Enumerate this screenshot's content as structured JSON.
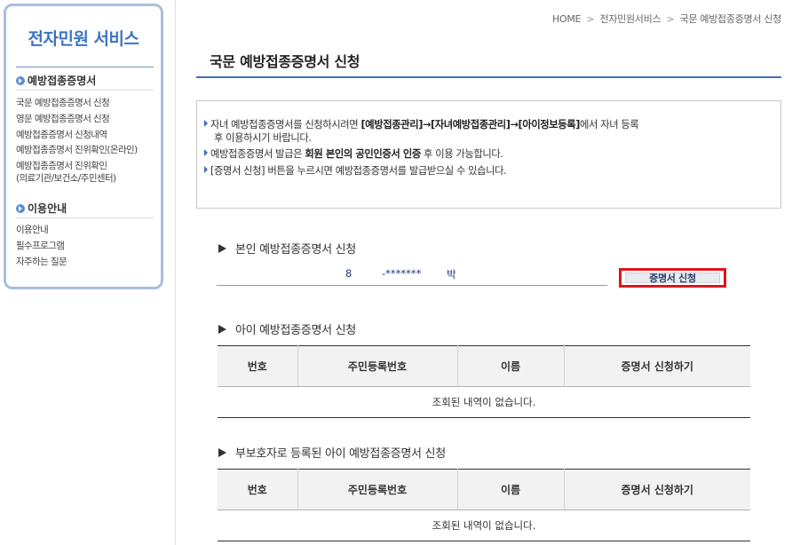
{
  "sidebar": {
    "title": "전자민원 서비스",
    "section1": {
      "heading": "예방접종증명서",
      "items": [
        {
          "label": "국문 예방접종증명서 신청"
        },
        {
          "label": "영문 예방접종증명서 신청"
        },
        {
          "label": "예방접종증명서 신청내역"
        },
        {
          "label": "예방접종증명서 진위확인(온라인)"
        },
        {
          "label": "예방접종증명서 진위확인"
        },
        {
          "label": "(의료기관/보건소/주민센터)"
        }
      ]
    },
    "section2": {
      "heading": "이용안내",
      "items": [
        {
          "label": "이용안내"
        },
        {
          "label": "필수프로그램"
        },
        {
          "label": "자주하는 질문"
        }
      ]
    }
  },
  "breadcrumb": {
    "home": "HOME",
    "level1": "전자민원서비스",
    "level2": "국문 예방접종증명서 신청",
    "separator": ">"
  },
  "page_title": "국문 예방접종증명서 신청",
  "notice": {
    "line1_a": "자녀 예방접종증명서를 신청하시려면 ",
    "line1_b": "[예방접종관리]→[자녀예방접종관리]→[아이정보등록]",
    "line1_c": "에서 자녀 등록",
    "line1_d": "후 이용하시기 바랍니다.",
    "line2_a": "예방접종증명서 발급은 ",
    "line2_b": "회원 본인의 공인인증서 인증",
    "line2_c": " 후 이용 가능합니다.",
    "line3": "[증명서 신청] 버튼을 누르시면 예방접종증명서를 발급받으실 수 있습니다."
  },
  "self_section": {
    "title": "본인 예방접종증명서 신청",
    "rrn_prefix": "8",
    "rrn_mask": "-*******",
    "name": "박",
    "button_label": "증명서 신청"
  },
  "child_section": {
    "title": "아이 예방접종증명서 신청",
    "columns": [
      "번호",
      "주민등록번호",
      "이름",
      "증명서 신청하기"
    ],
    "empty_message": "조회된 내역이 없습니다."
  },
  "guardian_section": {
    "title": "부보호자로 등록된 아이 예방접종증명서 신청",
    "columns": [
      "번호",
      "주민등록번호",
      "이름",
      "증명서 신청하기"
    ],
    "empty_message": "조회된 내역이 없습니다."
  },
  "colors": {
    "accent": "#3f6fba",
    "sidebar_border": "#a9bfe0",
    "sidebar_title": "#3a74c4",
    "highlight_red": "#e0141e"
  }
}
